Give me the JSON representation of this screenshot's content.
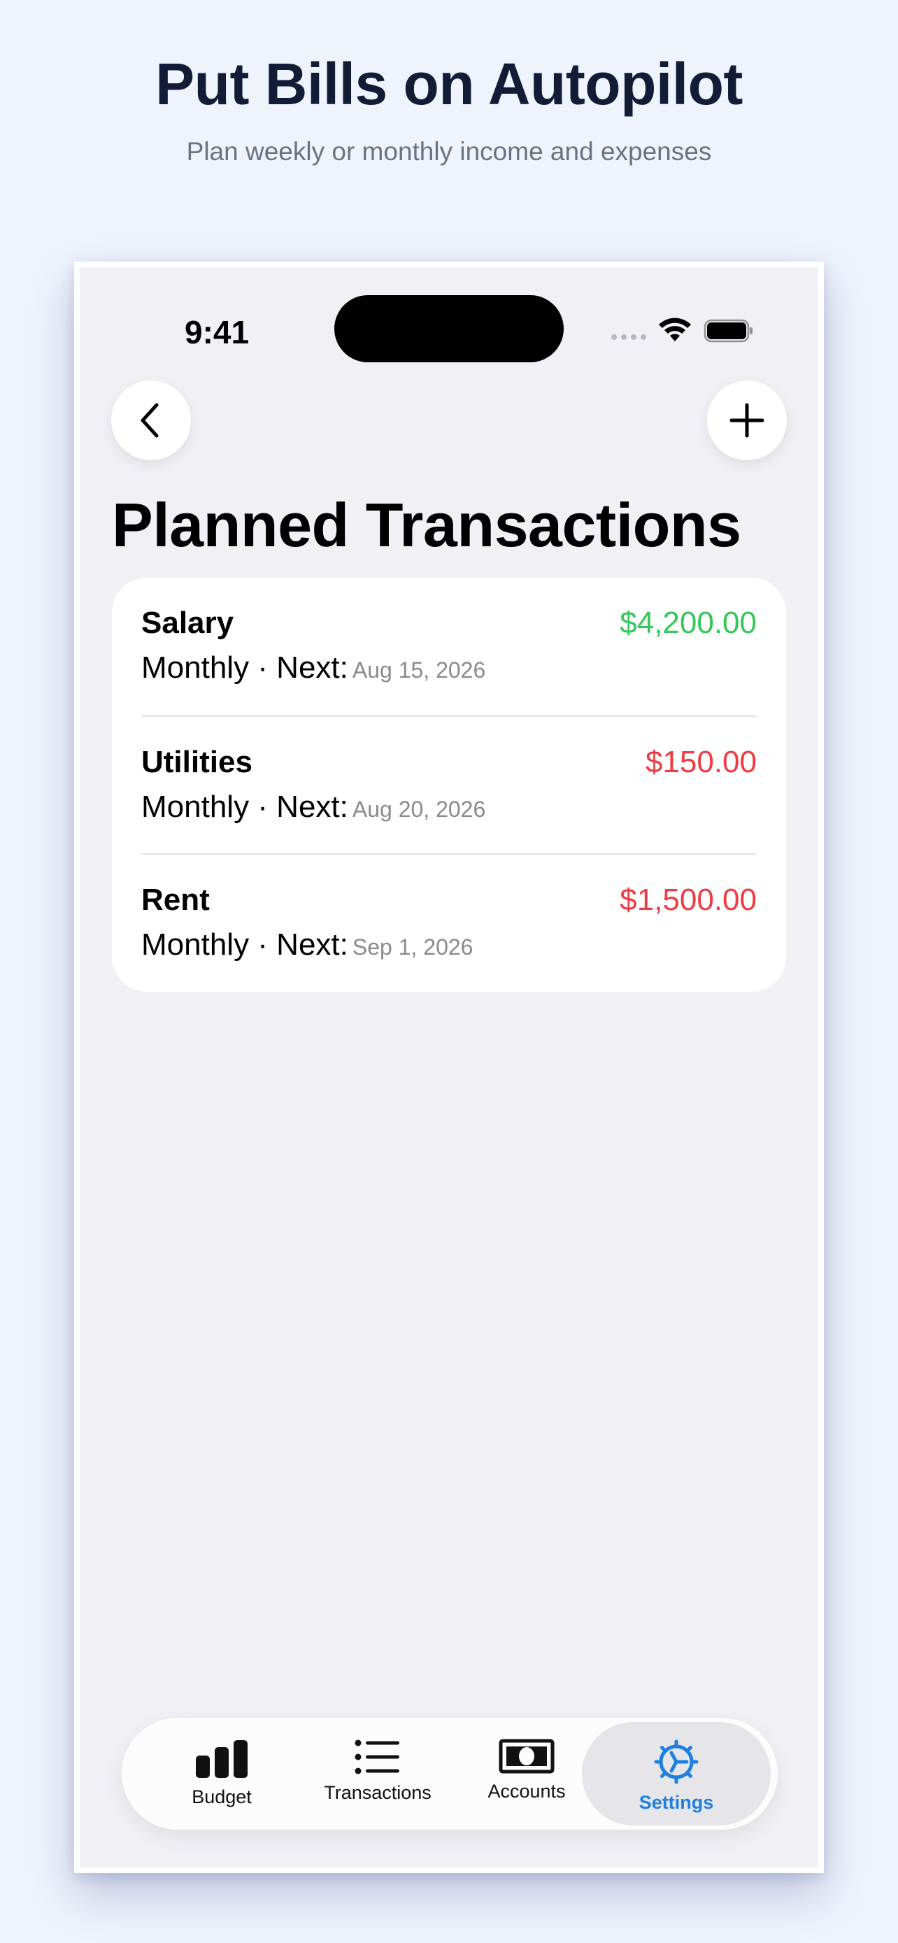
{
  "promo": {
    "headline": "Put Bills on Autopilot",
    "subhead": "Plan weekly or monthly income and expenses"
  },
  "status_bar": {
    "time": "9:41",
    "icons": [
      "cellular-icon",
      "wifi-icon",
      "battery-icon"
    ]
  },
  "nav": {
    "back_icon": "chevron-left-icon",
    "add_icon": "plus-icon"
  },
  "page": {
    "title": "Planned Transactions"
  },
  "transactions": [
    {
      "name": "Salary",
      "amount": "$4,200.00",
      "frequency": "Monthly · Next:",
      "next_date": "Aug 15, 2026",
      "type": "income"
    },
    {
      "name": "Utilities",
      "amount": "$150.00",
      "frequency": "Monthly · Next:",
      "next_date": "Aug 20, 2026",
      "type": "expense"
    },
    {
      "name": "Rent",
      "amount": "$1,500.00",
      "frequency": "Monthly · Next:",
      "next_date": "Sep 1, 2026",
      "type": "expense"
    }
  ],
  "tabbar": {
    "tabs": [
      {
        "label": "Budget",
        "icon": "bar-chart-icon"
      },
      {
        "label": "Transactions",
        "icon": "list-icon"
      },
      {
        "label": "Accounts",
        "icon": "banknote-icon"
      },
      {
        "label": "Settings",
        "icon": "gear-icon"
      }
    ],
    "selected": "Settings"
  },
  "colors": {
    "income": "#34c759",
    "expense": "#ef3b42",
    "accent": "#1f7fe0",
    "headline": "#121c36"
  }
}
